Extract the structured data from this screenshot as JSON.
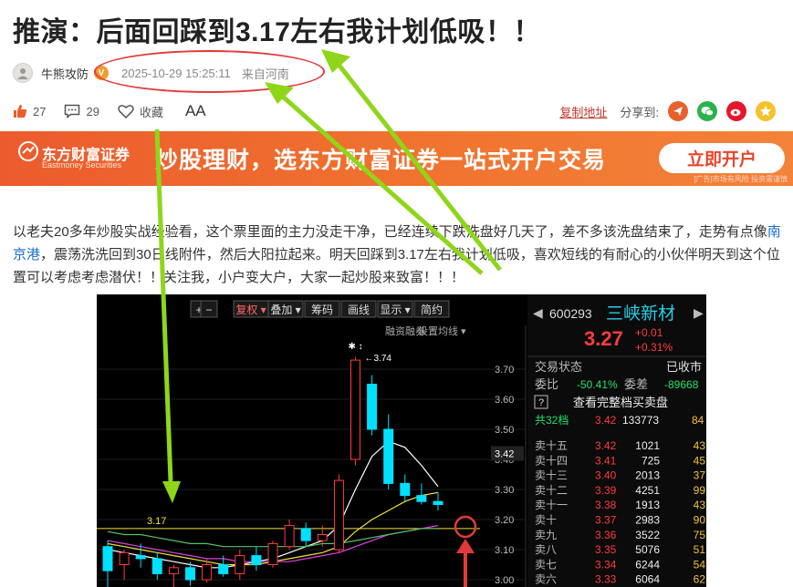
{
  "article": {
    "title": "推演：后面回踩到3.17左右我计划低吸！！",
    "author": "牛熊攻防",
    "verified_badge": "V",
    "publish_time": "2025-10-29 15:25:11",
    "location": "来自河南",
    "text_before": "以老夫20多年炒股实战经验看，这个票里面的主力没走干净，已经连续下跌洗盘好几天了，差不多该洗盘结束了，走势有点像",
    "stock_link": "南京港",
    "text_after": "，震荡洗洗回到30日线附件，然后大阳拉起来。明天回踩到3.17左右我计划低吸，喜欢短线的有耐心的小伙伴明天到这个位置可以考虑考虑潜伏！！关注我，小户变大户，大家一起炒股来致富！！！"
  },
  "actions": {
    "likes": "27",
    "comments": "29",
    "favorite_label": "收藏",
    "font_label": "AA",
    "copy_link": "复制地址",
    "share_label": "分享到:"
  },
  "banner": {
    "brand": "东方财富证券",
    "brand_en": "Eastmoney Securities",
    "slogan": "炒股理财，选东方财富证券一站式开户交易",
    "button": "立即开户",
    "note": "[广告]市场有风险 投资需谨慎"
  },
  "colors": {
    "up": "#ff3c3c",
    "down": "#00e0ff",
    "accent": "#f0742f",
    "annotation_arrow": "#8fd61a",
    "annotation_circle": "#e23a3a"
  },
  "chart_data": {
    "type": "candlestick",
    "toolbar": [
      "+",
      "−",
      "复权 ▾",
      "叠加 ▾",
      "筹码",
      "画线",
      "显示 ▾",
      "简约"
    ],
    "submenu": [
      "融资融券",
      "设置均线 ▾"
    ],
    "high_label": "3.74",
    "support_label": "3.17",
    "support_value": 3.17,
    "current_price_tag": "3.42",
    "yaxis_ticks": [
      "3.70",
      "3.60",
      "3.50",
      "3.40",
      "3.30",
      "3.20",
      "3.10",
      "3.00"
    ],
    "ylim": [
      3.0,
      3.74
    ],
    "candles": [
      {
        "o": 3.11,
        "h": 3.13,
        "l": 2.97,
        "c": 3.03
      },
      {
        "o": 3.05,
        "h": 3.1,
        "l": 3.0,
        "c": 3.09
      },
      {
        "o": 3.08,
        "h": 3.12,
        "l": 3.04,
        "c": 3.07
      },
      {
        "o": 3.07,
        "h": 3.09,
        "l": 3.0,
        "c": 3.02
      },
      {
        "o": 3.02,
        "h": 3.05,
        "l": 2.97,
        "c": 3.04
      },
      {
        "o": 3.04,
        "h": 3.06,
        "l": 2.98,
        "c": 3.0
      },
      {
        "o": 3.0,
        "h": 3.07,
        "l": 2.99,
        "c": 3.05
      },
      {
        "o": 3.05,
        "h": 3.08,
        "l": 3.01,
        "c": 3.02
      },
      {
        "o": 3.02,
        "h": 3.1,
        "l": 3.0,
        "c": 3.08
      },
      {
        "o": 3.08,
        "h": 3.11,
        "l": 3.03,
        "c": 3.05
      },
      {
        "o": 3.05,
        "h": 3.13,
        "l": 3.04,
        "c": 3.12
      },
      {
        "o": 3.11,
        "h": 3.2,
        "l": 3.1,
        "c": 3.18
      },
      {
        "o": 3.17,
        "h": 3.19,
        "l": 3.11,
        "c": 3.13
      },
      {
        "o": 3.13,
        "h": 3.18,
        "l": 3.11,
        "c": 3.15
      },
      {
        "o": 3.1,
        "h": 3.35,
        "l": 3.09,
        "c": 3.33
      },
      {
        "o": 3.4,
        "h": 3.74,
        "l": 3.38,
        "c": 3.73
      },
      {
        "o": 3.65,
        "h": 3.68,
        "l": 3.48,
        "c": 3.5
      },
      {
        "o": 3.5,
        "h": 3.55,
        "l": 3.3,
        "c": 3.32
      },
      {
        "o": 3.32,
        "h": 3.35,
        "l": 3.26,
        "c": 3.28
      },
      {
        "o": 3.28,
        "h": 3.32,
        "l": 3.25,
        "c": 3.26
      },
      {
        "o": 3.26,
        "h": 3.29,
        "l": 3.23,
        "c": 3.25
      }
    ],
    "ma_series": [
      {
        "color": "#ffffff",
        "values": [
          3.1,
          3.09,
          3.08,
          3.07,
          3.06,
          3.05,
          3.04,
          3.04,
          3.05,
          3.06,
          3.07,
          3.09,
          3.11,
          3.13,
          3.18,
          3.3,
          3.41,
          3.46,
          3.44,
          3.38,
          3.31
        ]
      },
      {
        "color": "#f2e23a",
        "values": [
          3.12,
          3.11,
          3.1,
          3.09,
          3.08,
          3.07,
          3.06,
          3.05,
          3.05,
          3.05,
          3.06,
          3.07,
          3.08,
          3.09,
          3.11,
          3.16,
          3.2,
          3.23,
          3.26,
          3.28,
          3.29
        ]
      },
      {
        "color": "#e040e0",
        "values": [
          3.13,
          3.12,
          3.11,
          3.1,
          3.09,
          3.08,
          3.07,
          3.07,
          3.06,
          3.06,
          3.06,
          3.06,
          3.07,
          3.08,
          3.09,
          3.11,
          3.13,
          3.15,
          3.16,
          3.17,
          3.18
        ]
      },
      {
        "color": "#4fc36a",
        "values": [
          3.16,
          3.15,
          3.15,
          3.14,
          3.13,
          3.12,
          3.12,
          3.11,
          3.11,
          3.11,
          3.11,
          3.11,
          3.11,
          3.12,
          3.12,
          3.13,
          3.14,
          3.15,
          3.16,
          3.17,
          3.17
        ]
      }
    ]
  },
  "quote": {
    "code": "600293",
    "name": "三峡新材",
    "price": "3.27",
    "change": "+0.01",
    "change_pct": "+0.31%",
    "status_label": "交易状态",
    "status": "已收市",
    "weibi_label": "委比",
    "weibi": "-50.41%",
    "weicha_label": "委差",
    "weicha": "-89668",
    "full_book": "查看完整档买卖盘",
    "total_levels_label": "共32档",
    "total_price": "3.42",
    "total_volume": "133773",
    "total_count": "84",
    "levels": [
      {
        "label": "卖十五",
        "price": "3.42",
        "volume": "1021",
        "count": "43"
      },
      {
        "label": "卖十四",
        "price": "3.41",
        "volume": "725",
        "count": "45"
      },
      {
        "label": "卖十三",
        "price": "3.40",
        "volume": "2013",
        "count": "37"
      },
      {
        "label": "卖十二",
        "price": "3.39",
        "volume": "4251",
        "count": "99"
      },
      {
        "label": "卖十一",
        "price": "3.38",
        "volume": "1913",
        "count": "43"
      },
      {
        "label": "卖十",
        "price": "3.37",
        "volume": "2983",
        "count": "90"
      },
      {
        "label": "卖九",
        "price": "3.36",
        "volume": "3522",
        "count": "75"
      },
      {
        "label": "卖八",
        "price": "3.35",
        "volume": "5076",
        "count": "51"
      },
      {
        "label": "卖七",
        "price": "3.34",
        "volume": "6244",
        "count": "54"
      },
      {
        "label": "卖六",
        "price": "3.33",
        "volume": "6064",
        "count": "62"
      }
    ]
  }
}
